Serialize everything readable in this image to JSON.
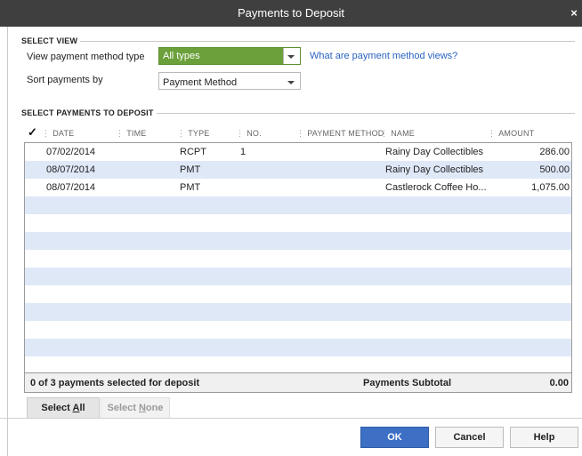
{
  "window": {
    "title": "Payments to Deposit",
    "close": "×"
  },
  "select_view": {
    "header": "SELECT VIEW",
    "method_type_label": "View payment method type",
    "method_type_value": "All types",
    "link": "What are payment method views?",
    "sort_label": "Sort payments by",
    "sort_value": "Payment Method"
  },
  "select_payments": {
    "header": "SELECT PAYMENTS TO DEPOSIT",
    "columns": {
      "check": "✓",
      "date": "DATE",
      "time": "TIME",
      "type": "TYPE",
      "no": "NO.",
      "payment_method": "PAYMENT METHOD",
      "name": "NAME",
      "amount": "AMOUNT"
    },
    "rows": [
      {
        "date": "07/02/2014",
        "time": "",
        "type": "RCPT",
        "no": "1",
        "payment_method": "",
        "name": "Rainy Day Collectibles",
        "amount": "286.00"
      },
      {
        "date": "08/07/2014",
        "time": "",
        "type": "PMT",
        "no": "",
        "payment_method": "",
        "name": "Rainy Day Collectibles",
        "amount": "500.00"
      },
      {
        "date": "08/07/2014",
        "time": "",
        "type": "PMT",
        "no": "",
        "payment_method": "",
        "name": "Castlerock Coffee Ho...",
        "amount": "1,075.00"
      }
    ],
    "footer": {
      "selected_text": "0 of 3 payments selected for deposit",
      "subtotal_label": "Payments Subtotal",
      "subtotal_value": "0.00"
    }
  },
  "buttons": {
    "select_all_pre": "Select ",
    "select_all_u": "A",
    "select_all_post": "ll",
    "select_none_pre": "Select ",
    "select_none_u": "N",
    "select_none_post": "one",
    "ok": "OK",
    "cancel": "Cancel",
    "help": "Help"
  },
  "colors": {
    "titlebar": "#3f3f3f",
    "accent_green": "#6ba03b",
    "ok_blue": "#3d6fc4",
    "alt_row": "#dfe8f7",
    "link": "#2a64c1"
  }
}
